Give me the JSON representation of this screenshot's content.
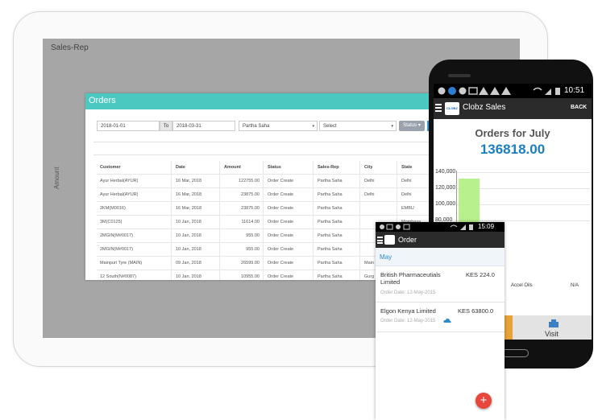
{
  "tablet": {
    "app_title": "Sales-Rep",
    "y_axis_label": "Amount",
    "orders": {
      "title": "Orders",
      "filters": {
        "date_from": "2018-01-01",
        "to_label": "To",
        "date_to": "2018-03-31",
        "rep": "Partha Saha",
        "select": "Select",
        "status_button": "Status ▾"
      },
      "columns": [
        "Customer",
        "Date",
        "Amount",
        "Status",
        "Sales-Rep",
        "City",
        "State"
      ],
      "rows": [
        [
          "Ayur Herbal(AYUR)",
          "16 Mar, 2018",
          "122755.00",
          "Order Create",
          "Partha Saha",
          "Delhi",
          "Delhi"
        ],
        [
          "Ayur Herbal(AYUR)",
          "16 Mar, 2018",
          "23875.00",
          "Order Create",
          "Partha Saha",
          "Delhi",
          "Delhi"
        ],
        [
          "2KM(M0016)",
          "16 Mar, 2018",
          "23875.00",
          "Order Create",
          "Partha Saha",
          "",
          "EMBU"
        ],
        [
          "3M(C0125)",
          "10 Jan, 2018",
          "11614.00",
          "Order Create",
          "Partha Saha",
          "",
          "Mombasa"
        ],
        [
          "2MGIN(M#0017)",
          "10 Jan, 2018",
          "955.00",
          "Order Create",
          "Partha Saha",
          "",
          ""
        ],
        [
          "2MGIN(M#0017)",
          "10 Jan, 2018",
          "955.00",
          "Order Create",
          "Partha Saha",
          "",
          ""
        ],
        [
          "Mainpuri Tyre (MAIN)",
          "09 Jan, 2018",
          "26599.00",
          "Order Create",
          "Partha Saha",
          "Main",
          ""
        ],
        [
          "12 South(N#0087)",
          "10 Jan, 2018",
          "10955.00",
          "Order Create",
          "Partha Saha",
          "Gurg",
          ""
        ]
      ]
    }
  },
  "phone": {
    "status_time": "10:51",
    "app_title": "Clobz Sales",
    "logo_text": "CLOBZ",
    "back_label": "BACK",
    "orders_title": "Orders for July",
    "orders_total": "136818.00",
    "chart_data": {
      "type": "bar",
      "categories": [
        "",
        "Accel Oils",
        "N/A"
      ],
      "values": [
        132000,
        0,
        0
      ],
      "ylim": [
        0,
        140000
      ],
      "yticks": [
        "140,000",
        "120,000",
        "100,000",
        "80,000"
      ],
      "bar_color": "#b8f08c"
    },
    "tab_visit_label": "Visit",
    "tab_visit_icon": "visit-icon"
  },
  "small_phone": {
    "status_time": "15:09",
    "app_title": "Order",
    "month": "May",
    "orders": [
      {
        "name": "British Pharmaceutials Limited",
        "amount": "KES 224.0",
        "date": "Order Date: 12-May-2015"
      },
      {
        "name": "Elgon Kenya Limited",
        "amount": "KES 63800.0",
        "date": "Order Date: 12-May-2015"
      }
    ],
    "fab_label": "+"
  },
  "colors": {
    "tablet_header": "#4bc8c0",
    "accent_blue": "#1a7fc1",
    "fab_red": "#e8453c",
    "tab_orange": "#e8a23a"
  }
}
